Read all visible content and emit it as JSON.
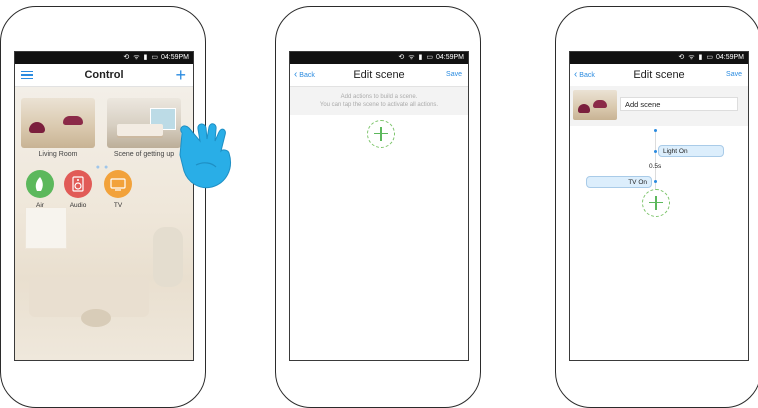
{
  "status": {
    "time": "04:59PM"
  },
  "phone1": {
    "title": "Control",
    "scenes": [
      {
        "label": "Living Room"
      },
      {
        "label": "Scene of getting up"
      }
    ],
    "devices": [
      {
        "label": "Air",
        "color": "#5cb85c",
        "icon": "air-icon"
      },
      {
        "label": "Audio",
        "color": "#e15b57",
        "icon": "speaker-icon"
      },
      {
        "label": "TV",
        "color": "#f2a23b",
        "icon": "tv-icon"
      }
    ]
  },
  "phone2": {
    "back": "Back",
    "title": "Edit scene",
    "save": "Save",
    "hint_line1": "Add actions to build a scene.",
    "hint_line2": "You can tap the scene to activate all actions."
  },
  "phone3": {
    "back": "Back",
    "title": "Edit scene",
    "save": "Save",
    "scene_name": "Add scene",
    "actions": [
      {
        "label": "Light On"
      },
      {
        "label": "0.5s"
      },
      {
        "label": "TV On"
      }
    ]
  },
  "colors": {
    "accent": "#2a8be0",
    "add": "#5cb85c"
  }
}
